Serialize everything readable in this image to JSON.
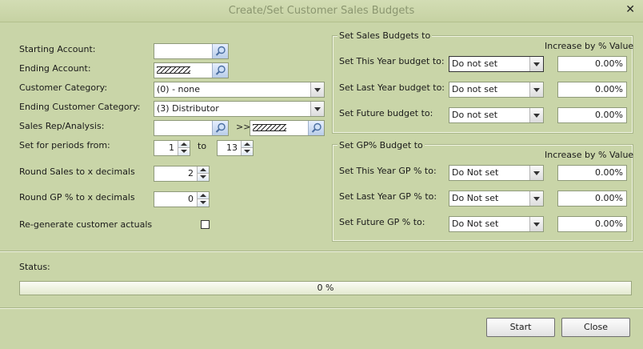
{
  "window": {
    "title": "Create/Set Customer Sales Budgets",
    "close_glyph": "✕"
  },
  "left": {
    "starting_account_label": "Starting Account:",
    "starting_account_value": "",
    "ending_account_label": "Ending Account:",
    "customer_category_label": "Customer Category:",
    "customer_category_value": "(0) - none",
    "ending_customer_category_label": "Ending Customer Category:",
    "ending_customer_category_value": "(3) Distributor",
    "sales_rep_label": "Sales Rep/Analysis:",
    "sales_rep_from_value": "",
    "sales_rep_sep": ">>",
    "periods_label": "Set for periods from:",
    "period_from": "1",
    "period_to_label": "to",
    "period_to": "13",
    "round_sales_label": "Round Sales to x decimals",
    "round_sales_value": "2",
    "round_gp_label": "Round GP % to x decimals",
    "round_gp_value": "0",
    "regen_label": "Re-generate customer actuals"
  },
  "sales_group": {
    "title": "Set Sales Budgets to",
    "increase_header": "Increase by % Value",
    "rows": [
      {
        "label": "Set This Year budget to:",
        "value": "Do not set",
        "pct": "0.00%"
      },
      {
        "label": "Set Last Year budget to:",
        "value": "Do not set",
        "pct": "0.00%"
      },
      {
        "label": "Set Future budget to:",
        "value": "Do not set",
        "pct": "0.00%"
      }
    ]
  },
  "gp_group": {
    "title": "Set GP% Budget to",
    "increase_header": "Increase by % Value",
    "rows": [
      {
        "label": "Set This Year GP % to:",
        "value": "Do Not set",
        "pct": "0.00%"
      },
      {
        "label": "Set Last Year GP % to:",
        "value": "Do Not set",
        "pct": "0.00%"
      },
      {
        "label": "Set Future GP % to:",
        "value": "Do Not set",
        "pct": "0.00%"
      }
    ]
  },
  "status": {
    "label": "Status:",
    "progress_text": "0 %",
    "progress_fraction": 0
  },
  "buttons": {
    "start": "Start",
    "close": "Close"
  }
}
